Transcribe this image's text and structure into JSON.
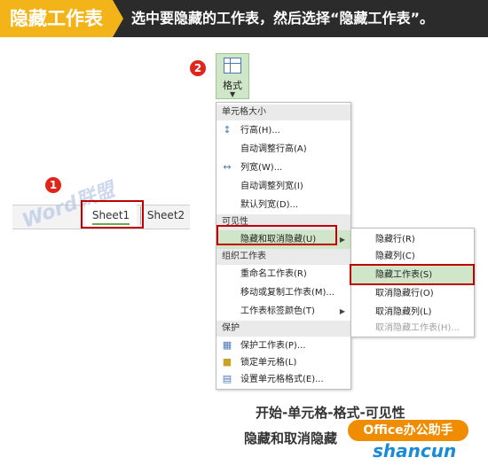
{
  "banner": {
    "tag": "隐藏工作表",
    "text": "选中要隐藏的工作表，然后选择“隐藏工作表”。"
  },
  "steps": {
    "one": "1",
    "two": "2"
  },
  "ribbon": {
    "format_label": "格式"
  },
  "sheet_tabs": {
    "sheet1": "Sheet1",
    "sheet2": "Sheet2"
  },
  "watermark": "Word联盟",
  "menu": {
    "cell_size_header": "单元格大小",
    "row_height": "行高(H)...",
    "autofit_row": "自动调整行高(A)",
    "col_width": "列宽(W)...",
    "autofit_col": "自动调整列宽(I)",
    "default_width": "默认列宽(D)...",
    "visibility_header": "可见性",
    "hide_unhide": "隐藏和取消隐藏(U)",
    "organize_header": "组织工作表",
    "rename": "重命名工作表(R)",
    "move_copy": "移动或复制工作表(M)...",
    "tab_color": "工作表标签颜色(T)",
    "protect_header": "保护",
    "protect_sheet": "保护工作表(P)...",
    "lock_cell": "锁定单元格(L)",
    "format_cells": "设置单元格格式(E)..."
  },
  "submenu": {
    "hide_rows": "隐藏行(R)",
    "hide_cols": "隐藏列(C)",
    "hide_sheet": "隐藏工作表(S)",
    "unhide_rows": "取消隐藏行(O)",
    "unhide_cols": "取消隐藏列(L)",
    "unhide_sheet": "取消隐藏工作表(H)..."
  },
  "caption": {
    "line1": "开始-单元格-格式-可见性",
    "line2": "隐藏和取消隐藏"
  },
  "logo": "Office办公助手",
  "site": "shancun"
}
